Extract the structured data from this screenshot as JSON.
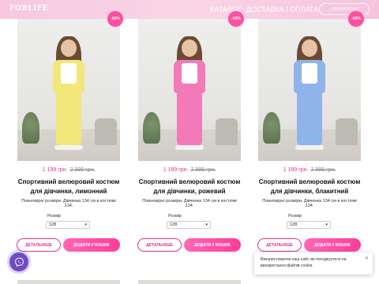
{
  "header": {
    "logo": "FORLIFE",
    "nav": {
      "catalog": "КАТАЛОГ",
      "delivery": "ДОСТАВКА І ОПЛАТА"
    },
    "phone": "+380993452449",
    "gradient": [
      "#f7c8df",
      "#f6c3dc"
    ]
  },
  "products": [
    {
      "badge": "-60%",
      "price_new": "1 199 грн.",
      "price_old": "2 999 грн.",
      "title": "Спортивний велюровий костюм для дівчинки, лимонний",
      "description": "Повномірні розміри. Дівчинка 134 см в костюмі 134.",
      "size_label": "Розмір",
      "size_value": "128",
      "details_button": "ДЕТАЛЬНІШЕ",
      "cart_button": "ДОДАТИ У КОШИК",
      "outfit_color": "#f2e77a"
    },
    {
      "badge": "-60%",
      "price_new": "1 199 грн.",
      "price_old": "2 999 грн.",
      "title": "Спортивний велюровий костюм для дівчинки, рожевий",
      "description": "Повномірні розміри. Дівчинка 134 см в костюмі 134.",
      "size_label": "Розмір",
      "size_value": "128",
      "details_button": "ДЕТАЛЬНІШЕ",
      "cart_button": "ДОДАТИ У КОШИК",
      "outfit_color": "#f27ab8"
    },
    {
      "badge": "-60%",
      "price_new": "1 199 грн.",
      "price_old": "2 999 грн.",
      "title": "Спортивний велюровий костюм для дівчинки, блакитний",
      "description": "Повномірні розміри. Дівчинка 134 см в костюмі 134.",
      "size_label": "Розмір",
      "size_value": "128",
      "details_button": "ДЕТАЛЬНІШЕ",
      "cart_button": "ДОДАТИ У КОШИК",
      "outfit_color": "#8fb3ea"
    }
  ],
  "cookie": {
    "text": "Використовуючи наш сайт, ви погоджуєтеся на використання файлів cookie.",
    "close_icon": "close-icon"
  },
  "viber_icon": "viber-icon",
  "colors": {
    "accent": "#e8318e",
    "badge": "#ff4fa0",
    "viber": "#6f4bc7"
  }
}
